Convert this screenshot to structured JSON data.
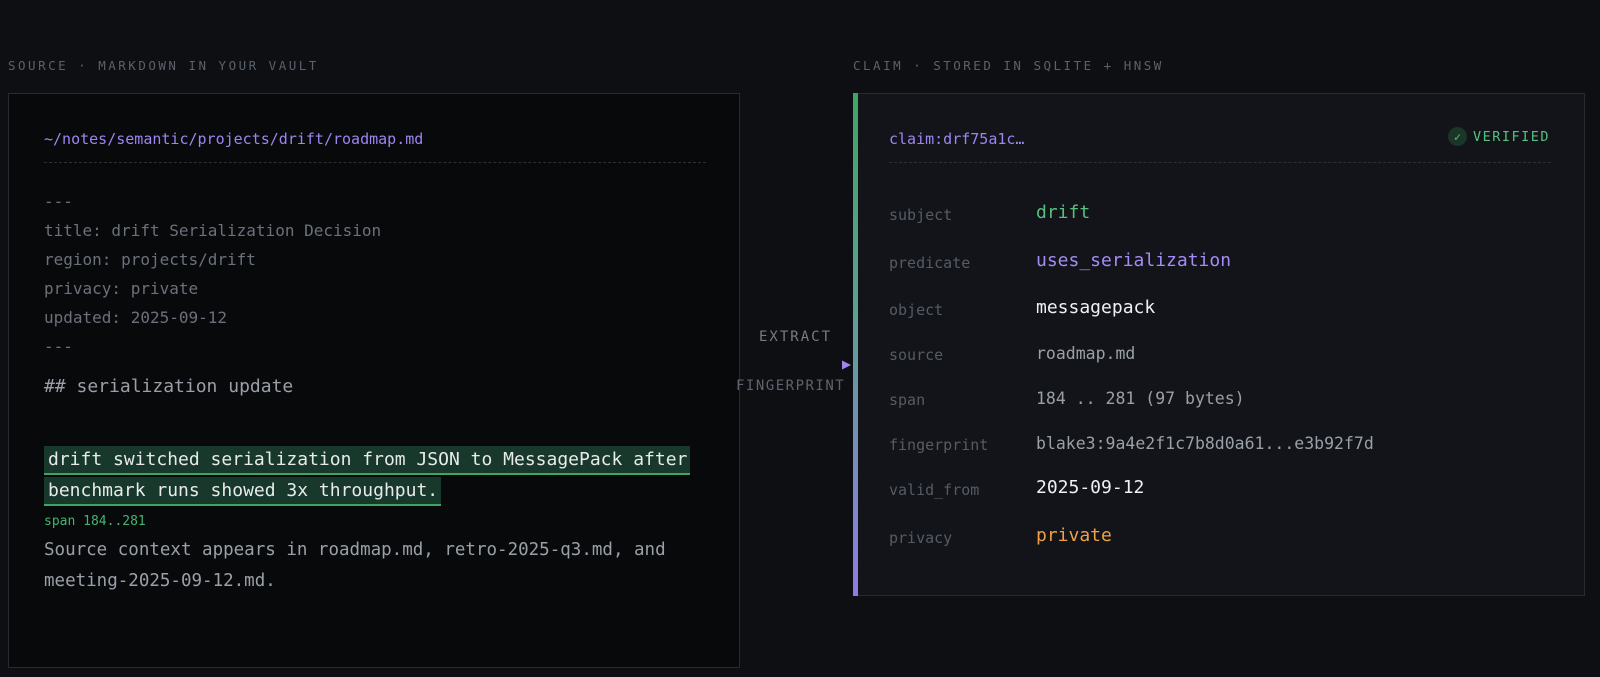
{
  "source": {
    "caption": "SOURCE · MARKDOWN IN YOUR VAULT",
    "path": "~/notes/semantic/projects/drift/roadmap.md",
    "frontmatter": [
      "---",
      "title: drift Serialization Decision",
      "region: projects/drift",
      "privacy: private",
      "updated: 2025-09-12",
      "---"
    ],
    "heading": "## serialization update",
    "highlight": [
      "drift switched serialization from JSON to MessagePack after",
      "benchmark runs showed 3x throughput."
    ],
    "span_label": "span 184..281",
    "context": "Source context appears in roadmap.md, retro-2025-q3.md, and meeting-2025-09-12.md."
  },
  "connector": {
    "top_label": "EXTRACT",
    "bottom_label": "FINGERPRINT"
  },
  "claim": {
    "caption": "CLAIM · STORED IN SQLITE + HNSW",
    "id": "claim:drf75a1c…",
    "status": "VERIFIED",
    "check_glyph": "✓",
    "fields": [
      {
        "key": "subject",
        "value": "drift",
        "color": "#56c17e"
      },
      {
        "key": "predicate",
        "value": "uses_serialization",
        "color": "#a48cf4"
      },
      {
        "key": "object",
        "value": "messagepack",
        "color": "#eef0f3"
      },
      {
        "key": "source",
        "value": "roadmap.md",
        "color": "#9aa0a8"
      },
      {
        "key": "span",
        "value": "184 .. 281 (97 bytes)",
        "color": "#9aa0a8"
      },
      {
        "key": "fingerprint",
        "value": "blake3:9a4e2f1c7b8d0a61...e3b92f7d",
        "color": "#9aa0a8"
      },
      {
        "key": "valid_from",
        "value": "2025-09-12",
        "color": "#eef0f3"
      },
      {
        "key": "privacy",
        "value": "private",
        "color": "#f0a043"
      }
    ]
  },
  "colors": {
    "accent_purple": "#9d85f2",
    "accent_green": "#3fa565",
    "accent_orange": "#f0a043",
    "background": "#0d0f12"
  }
}
